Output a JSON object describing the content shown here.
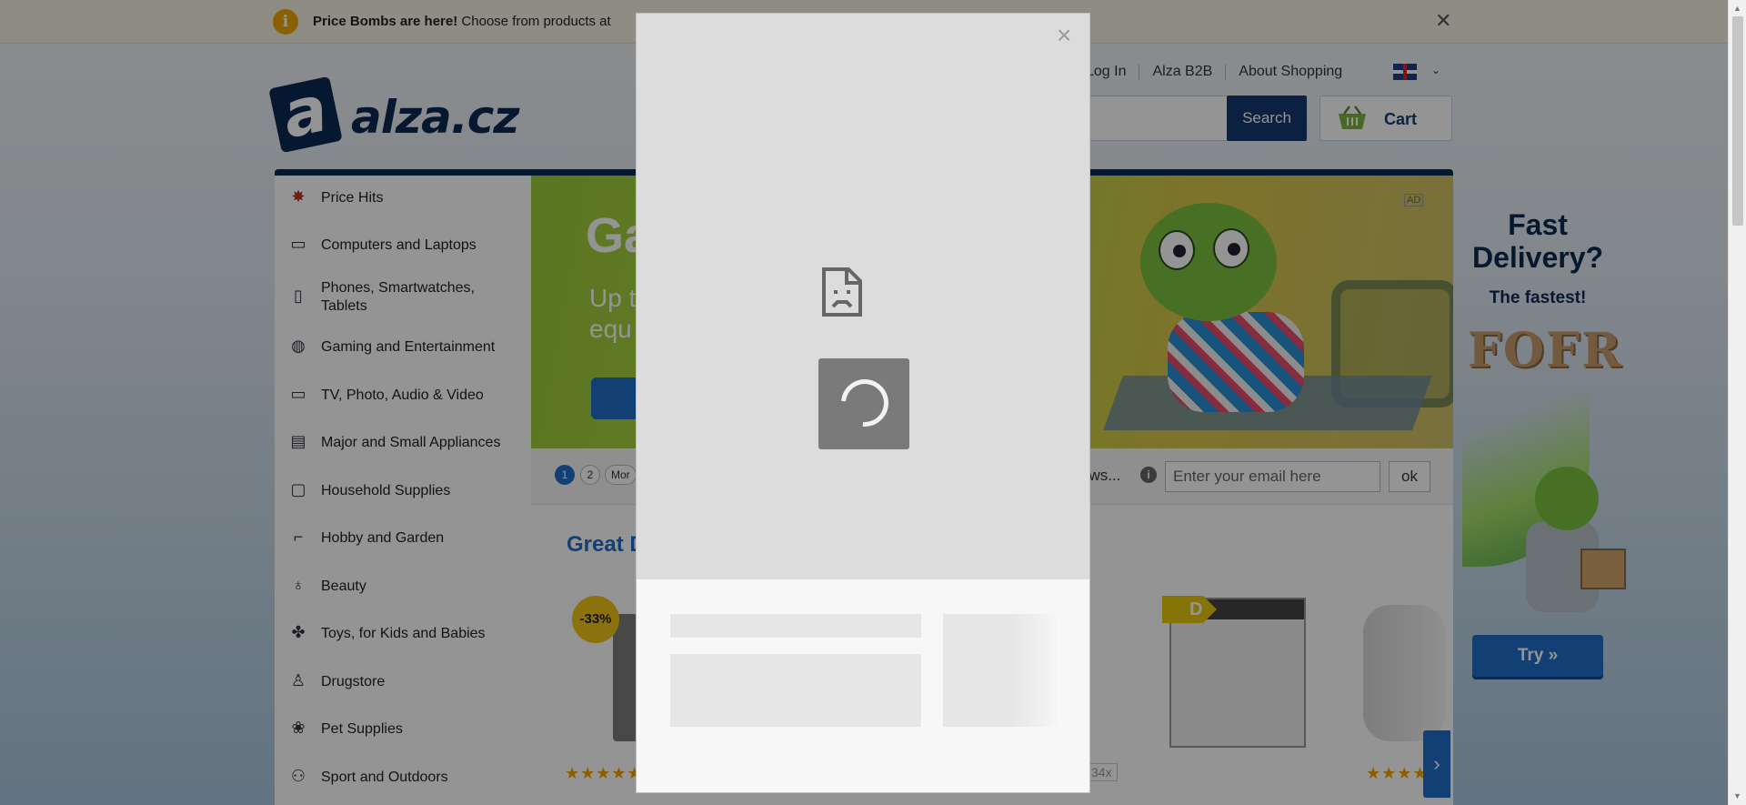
{
  "promo": {
    "bold": "Price Bombs are here!",
    "text": "Choose from products at",
    "info_icon": "info-icon",
    "close_icon": "close-icon"
  },
  "header": {
    "logo_text": "alza.cz",
    "logo_mark": "a",
    "links": [
      "Log In",
      "Alza B2B",
      "About Shopping"
    ],
    "language_icon": "uk-flag-icon",
    "search_button": "Search",
    "cart_label": "Cart"
  },
  "sidebar": {
    "items": [
      {
        "label": "Price Hits",
        "icon": "bomb-icon"
      },
      {
        "label": "Computers and Laptops",
        "icon": "laptop-icon"
      },
      {
        "label": "Phones, Smartwatches, Tablets",
        "icon": "phone-icon"
      },
      {
        "label": "Gaming and Entertainment",
        "icon": "gamepad-icon"
      },
      {
        "label": "TV, Photo, Audio & Video",
        "icon": "tv-icon"
      },
      {
        "label": "Major and Small Appliances",
        "icon": "appliance-icon"
      },
      {
        "label": "Household Supplies",
        "icon": "household-icon"
      },
      {
        "label": "Hobby and Garden",
        "icon": "drill-icon"
      },
      {
        "label": "Beauty",
        "icon": "beauty-icon"
      },
      {
        "label": "Toys, for Kids and Babies",
        "icon": "toy-icon"
      },
      {
        "label": "Drugstore",
        "icon": "drugstore-icon"
      },
      {
        "label": "Pet Supplies",
        "icon": "paw-icon"
      },
      {
        "label": "Sport and Outdoors",
        "icon": "bike-icon"
      }
    ]
  },
  "hero": {
    "title": "Ga",
    "subtitle_line1": "Up t",
    "subtitle_line2": "equ",
    "ad_marker": "AD"
  },
  "slider": {
    "pages": [
      "1",
      "2"
    ],
    "more": "Mor",
    "newsletter_label": "ews...",
    "email_placeholder": "Enter your email here",
    "ok_button": "ok"
  },
  "deals": {
    "title": "Great D",
    "discount_badge": "-33%",
    "energy_class": "D",
    "review_count": "34x",
    "stars": "★★★★★",
    "stars_partial": "★★★★",
    "next_icon": "chevron-right-icon"
  },
  "side_ad": {
    "headline": "Fast Delivery?",
    "subline": "The fastest!",
    "brand": "FOFR",
    "cta": "Try »"
  },
  "modal": {
    "close_icon": "close-icon",
    "error_icon": "broken-page-icon",
    "loading_icon": "spinner-icon"
  }
}
